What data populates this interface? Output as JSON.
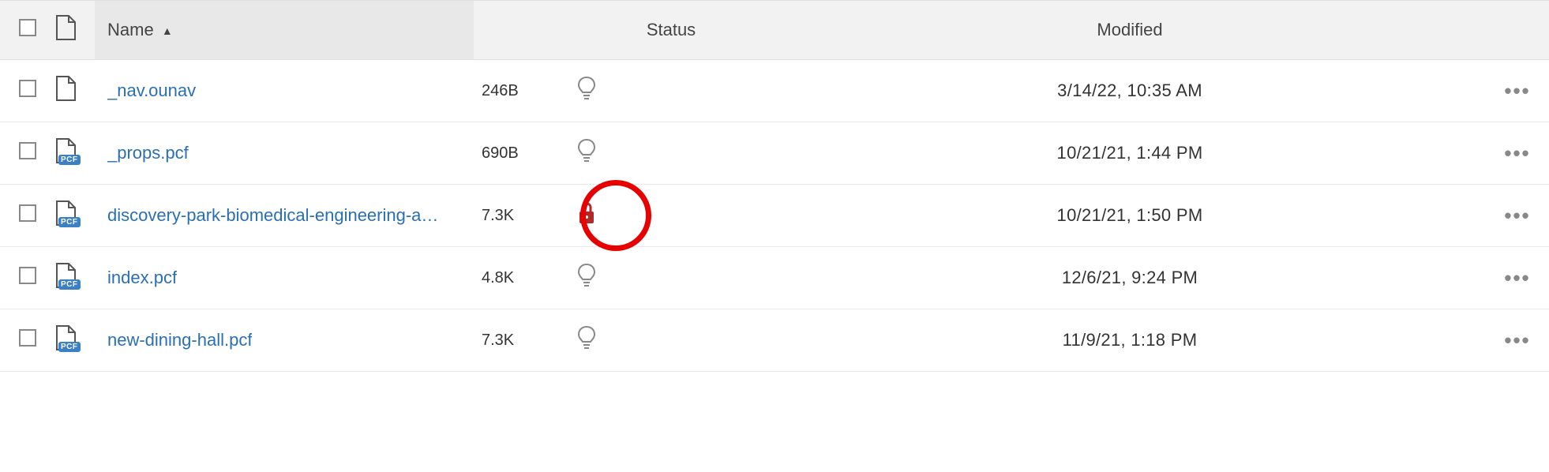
{
  "columns": {
    "name": "Name",
    "status": "Status",
    "modified": "Modified",
    "sort_indicator": "▲"
  },
  "files": [
    {
      "name": "_nav.ounav",
      "icon": "plain",
      "size": "246B",
      "status": "bulb",
      "modified": "3/14/22, 10:35 AM"
    },
    {
      "name": "_props.pcf",
      "icon": "pcf",
      "size": "690B",
      "status": "bulb",
      "modified": "10/21/21, 1:44 PM"
    },
    {
      "name": "discovery-park-biomedical-engineering-a…",
      "icon": "pcf",
      "size": "7.3K",
      "status": "lock",
      "highlight": true,
      "modified": "10/21/21, 1:50 PM"
    },
    {
      "name": "index.pcf",
      "icon": "pcf",
      "size": "4.8K",
      "status": "bulb",
      "modified": "12/6/21, 9:24 PM"
    },
    {
      "name": "new-dining-hall.pcf",
      "icon": "pcf",
      "size": "7.3K",
      "status": "bulb",
      "modified": "11/9/21, 1:18 PM"
    }
  ],
  "icon_labels": {
    "pcf_badge": "PCF",
    "actions": "•••"
  }
}
